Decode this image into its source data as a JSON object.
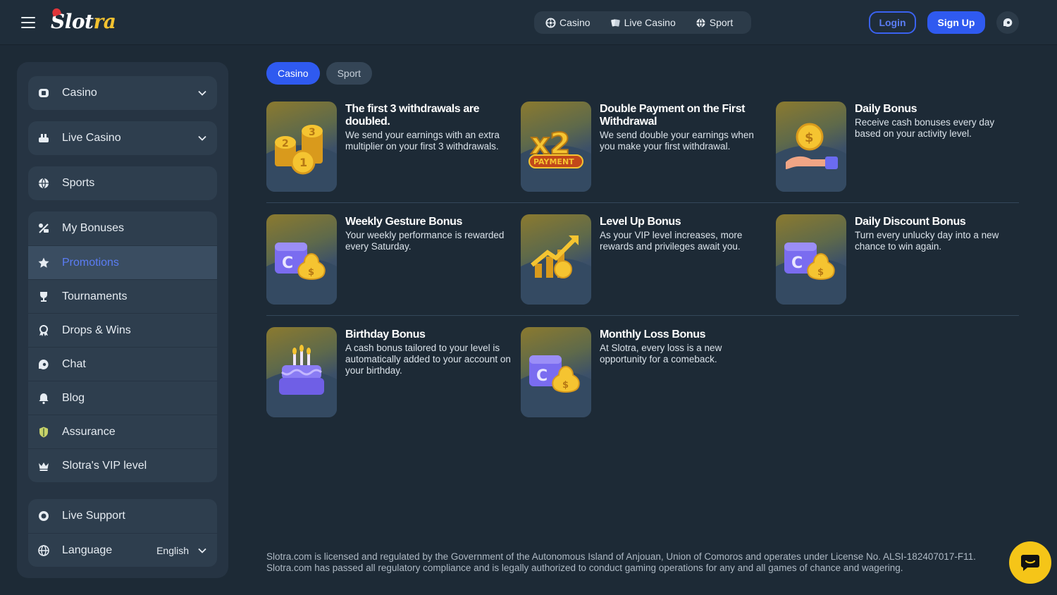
{
  "header": {
    "logo": {
      "main": "Slot",
      "accent": "ra"
    },
    "nav": [
      {
        "label": "Casino",
        "icon": "roulette-icon"
      },
      {
        "label": "Live Casino",
        "icon": "cards-icon"
      },
      {
        "label": "Sport",
        "icon": "ball-icon"
      }
    ],
    "login_label": "Login",
    "signup_label": "Sign Up"
  },
  "sidebar": {
    "group1": [
      {
        "label": "Casino",
        "icon": "casino-chip-icon",
        "expandable": true
      },
      {
        "label": "Live Casino",
        "icon": "live-casino-icon",
        "expandable": true
      },
      {
        "label": "Sports",
        "icon": "ball-icon",
        "expandable": false
      }
    ],
    "group2": [
      {
        "label": "My Bonuses",
        "icon": "bonus-icon"
      },
      {
        "label": "Promotions",
        "icon": "star-icon",
        "active": true
      },
      {
        "label": "Tournaments",
        "icon": "trophy-icon"
      },
      {
        "label": "Drops & Wins",
        "icon": "drops-icon"
      },
      {
        "label": "Chat",
        "icon": "chat-icon"
      },
      {
        "label": "Blog",
        "icon": "bell-icon"
      },
      {
        "label": "Assurance",
        "icon": "shield-icon"
      },
      {
        "label": "Slotra's VIP level",
        "icon": "crown-icon"
      }
    ],
    "group3": {
      "live_support": "Live Support",
      "language_label": "Language",
      "language_value": "English"
    }
  },
  "tabs": [
    {
      "label": "Casino",
      "active": true
    },
    {
      "label": "Sport",
      "active": false
    }
  ],
  "promotions": [
    {
      "title": "The first 3 withdrawals are doubled.",
      "description": "We send your earnings with an extra multiplier on your first 3 withdrawals.",
      "art": "coins"
    },
    {
      "title": "Double Payment on the First Withdrawal",
      "description": "We send double your earnings when you make your first withdrawal.",
      "art": "x2"
    },
    {
      "title": "Daily Bonus",
      "description": "Receive cash bonuses every day based on your activity level.",
      "art": "hand-coin"
    },
    {
      "title": "Weekly Gesture Bonus",
      "description": "Your weekly performance is rewarded every Saturday.",
      "art": "calendar-bag"
    },
    {
      "title": "Level Up Bonus",
      "description": "As your VIP level increases, more rewards and privileges await you.",
      "art": "chart-up"
    },
    {
      "title": "Daily Discount Bonus",
      "description": "Turn every unlucky day into a new chance to win again.",
      "art": "calendar-bag"
    },
    {
      "title": "Birthday Bonus",
      "description": "A cash bonus tailored to your level is automatically added to your account on your birthday.",
      "art": "cake"
    },
    {
      "title": "Monthly Loss Bonus",
      "description": "At Slotra, every loss is a new opportunity for a comeback.",
      "art": "calendar-bag"
    }
  ],
  "footer": {
    "line1": "Slotra.com is licensed and regulated by the Government of the Autonomous Island of Anjouan, Union of Comoros and operates under License No. ALSI-182407017-F11.",
    "line2": "Slotra.com has passed all regulatory compliance and is legally authorized to conduct gaming operations for any and all games of chance and wagering."
  },
  "colors": {
    "background": "#1d2a36",
    "accent_blue": "#2f5af0",
    "chat_fab": "#f5c518"
  }
}
